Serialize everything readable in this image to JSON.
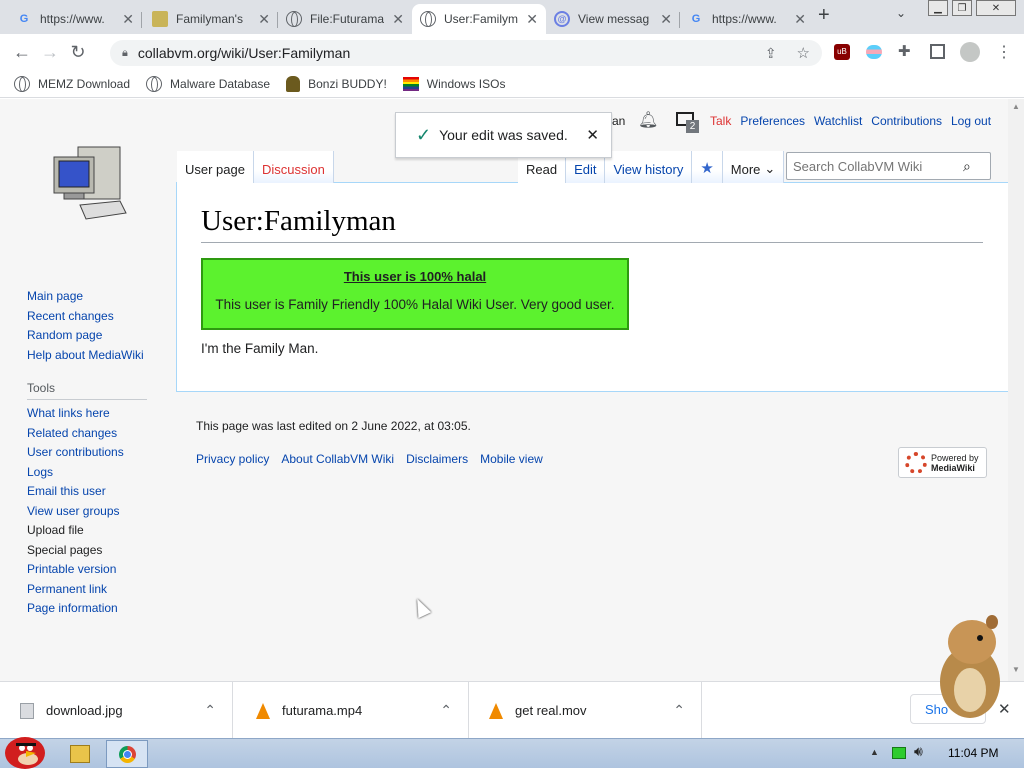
{
  "browser": {
    "tabs": [
      {
        "title": "https://www.",
        "icon": "google-icon"
      },
      {
        "title": "Familyman's",
        "icon": "image-icon"
      },
      {
        "title": "File:Futurama",
        "icon": "globe-icon"
      },
      {
        "title": "User:Familym",
        "icon": "globe-icon"
      },
      {
        "title": "View messag",
        "icon": "at-icon"
      },
      {
        "title": "https://www.",
        "icon": "google-icon"
      }
    ],
    "new_tab_label": "+",
    "url": "collabvm.org/wiki/User:Familyman",
    "bookmarks": [
      "MEMZ Download",
      "Malware Database",
      "Bonzi BUDDY!",
      "Windows ISOs"
    ]
  },
  "wiki": {
    "sidebar_nav": [
      "Main page",
      "Recent changes",
      "Random page",
      "Help about MediaWiki"
    ],
    "tools_heading": "Tools",
    "tools": [
      "What links here",
      "Related changes",
      "User contributions",
      "Logs",
      "Email this user",
      "View user groups",
      "Upload file",
      "Special pages",
      "Printable version",
      "Permanent link",
      "Page information"
    ],
    "personal": {
      "user_tail": "an",
      "notif_count": "2",
      "talk": "Talk",
      "preferences": "Preferences",
      "watchlist": "Watchlist",
      "contributions": "Contributions",
      "logout": "Log out"
    },
    "page_tabs": {
      "user_page": "User page",
      "discussion": "Discussion",
      "read": "Read",
      "edit": "Edit",
      "history": "View history",
      "more": "More"
    },
    "search_placeholder": "Search CollabVM Wiki",
    "title": "User:Familyman",
    "userbox": {
      "heading": "This user is 100% halal",
      "text": "This user is Family Friendly 100% Halal Wiki User. Very good user."
    },
    "body_text": "I'm the Family Man.",
    "last_edited": "This page was last edited on 2 June 2022, at 03:05.",
    "footer_links": [
      "Privacy policy",
      "About CollabVM Wiki",
      "Disclaimers",
      "Mobile view"
    ],
    "badge": {
      "line1": "Powered by",
      "line2": "MediaWiki"
    },
    "toast": "Your edit was saved."
  },
  "downloads": [
    {
      "name": "download.jpg",
      "icon": "image-file-icon"
    },
    {
      "name": "futurama.mp4",
      "icon": "vlc-icon"
    },
    {
      "name": "get real.mov",
      "icon": "vlc-icon"
    }
  ],
  "downloads_show_all": "Sho",
  "taskbar": {
    "clock": "11:04 PM"
  },
  "colors": {
    "link": "#0645ad",
    "redlink": "#d33",
    "userbox_bg": "#5cf22e",
    "userbox_border": "#2e9a10"
  }
}
